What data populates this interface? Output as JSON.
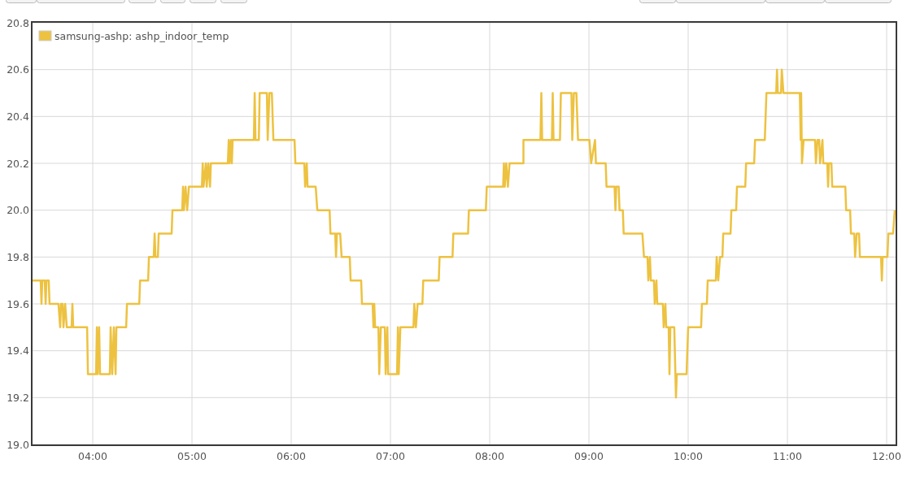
{
  "chart": {
    "chart_data": {
      "type": "line",
      "grid": true,
      "x": [
        203.6,
        208.5,
        209.0,
        209.5,
        211.0,
        211.5,
        212.0,
        213.4,
        213.9,
        219.3,
        220.3,
        220.8,
        221.8,
        222.3,
        223.3,
        224.3,
        227.2,
        227.7,
        228.2,
        236.6,
        237.1,
        242.0,
        242.5,
        243.0,
        243.9,
        244.4,
        250.3,
        250.8,
        251.8,
        252.8,
        253.8,
        254.3,
        260.2,
        260.7,
        268.1,
        268.6,
        273.5,
        274.0,
        276.9,
        277.4,
        277.9,
        279.4,
        279.9,
        287.7,
        288.2,
        294.1,
        294.6,
        295.1,
        296.1,
        297.1,
        298.1,
        306.0,
        306.5,
        307.0,
        308.4,
        308.9,
        309.9,
        310.9,
        311.4,
        321.7,
        322.2,
        322.7,
        323.6,
        324.1,
        324.6,
        337.4,
        337.9,
        338.4,
        340.4,
        340.9,
        345.3,
        345.8,
        346.8,
        348.3,
        349.2,
        362.0,
        362.5,
        367.9,
        368.4,
        369.4,
        369.9,
        374.8,
        375.8,
        383.2,
        383.7,
        386.6,
        387.1,
        387.6,
        389.6,
        390.5,
        395.4,
        395.9,
        402.3,
        402.8,
        409.2,
        409.7,
        410.2,
        410.7,
        412.7,
        413.2,
        414.2,
        416.6,
        417.1,
        418.1,
        418.6,
        424.0,
        424.5,
        425.0,
        426.0,
        427.5,
        433.9,
        434.4,
        435.4,
        436.4,
        439.3,
        439.8,
        449.2,
        449.7,
        457.5,
        458.0,
        466.9,
        467.4,
        477.7,
        478.2,
        488.1,
        488.6,
        489.1,
        490.0,
        491.0,
        492.0,
        500.4,
        500.4,
        510.7,
        511.2,
        511.7,
        517.6,
        518.1,
        518.6,
        522.5,
        523.0,
        529.4,
        529.9,
        530.9,
        532.4,
        533.4,
        540.3,
        541.3,
        543.7,
        544.2,
        550.1,
        550.6,
        555.5,
        556.0,
        556.5,
        558.0,
        558.5,
        560.5,
        561.0,
        572.3,
        573.3,
        575.4,
        575.9,
        576.9,
        577.4,
        579.3,
        579.8,
        580.8,
        581.3,
        584.7,
        585.2,
        586.2,
        586.7,
        588.2,
        588.7,
        589.2,
        591.6,
        592.6,
        593.1,
        599.0,
        600.0,
        607.8,
        608.3,
        611.3,
        611.8,
        616.7,
        617.2,
        618.2,
        619.2,
        620.7,
        621.2,
        625.6,
        626.1,
        629.0,
        629.5,
        634.5,
        635.0,
        639.9,
        640.4,
        646.3,
        647.3,
        653.2,
        653.7,
        654.2,
        656.1,
        656.6,
        657.6,
        667.5,
        668.0,
        668.3,
        668.8,
        669.8,
        676.7,
        677.2,
        678.2,
        679.2,
        679.7,
        681.2,
        681.7,
        684.1,
        684.6,
        685.1,
        686.6,
        687.1,
        695.0,
        695.5,
        697.9,
        698.4,
        700.4,
        700.9,
        701.9,
        703.3,
        703.8,
        716.6,
        717.1,
        717.6,
        720.5,
        721.0,
        723.9,
        724.9
      ],
      "series": [
        {
          "name": "samsung-ashp: ashp_indoor_temp",
          "color": "#edc240",
          "values": [
            19.7,
            19.7,
            19.6,
            19.7,
            19.7,
            19.6,
            19.7,
            19.7,
            19.6,
            19.6,
            19.5,
            19.6,
            19.6,
            19.5,
            19.6,
            19.5,
            19.5,
            19.6,
            19.5,
            19.5,
            19.3,
            19.3,
            19.5,
            19.3,
            19.5,
            19.3,
            19.3,
            19.5,
            19.3,
            19.5,
            19.3,
            19.5,
            19.5,
            19.6,
            19.6,
            19.7,
            19.7,
            19.8,
            19.8,
            19.9,
            19.8,
            19.8,
            19.9,
            19.9,
            20.0,
            20.0,
            20.1,
            20.0,
            20.1,
            20.0,
            20.1,
            20.1,
            20.2,
            20.1,
            20.2,
            20.1,
            20.2,
            20.1,
            20.2,
            20.2,
            20.3,
            20.2,
            20.3,
            20.2,
            20.3,
            20.3,
            20.5,
            20.3,
            20.3,
            20.5,
            20.5,
            20.3,
            20.5,
            20.5,
            20.3,
            20.3,
            20.2,
            20.2,
            20.1,
            20.2,
            20.1,
            20.1,
            20.0,
            20.0,
            19.9,
            19.9,
            19.8,
            19.9,
            19.9,
            19.8,
            19.8,
            19.7,
            19.7,
            19.6,
            19.6,
            19.5,
            19.6,
            19.5,
            19.5,
            19.3,
            19.5,
            19.5,
            19.3,
            19.5,
            19.3,
            19.3,
            19.5,
            19.3,
            19.5,
            19.5,
            19.5,
            19.6,
            19.5,
            19.6,
            19.6,
            19.7,
            19.7,
            19.8,
            19.8,
            19.9,
            19.9,
            20.0,
            20.0,
            20.1,
            20.1,
            20.2,
            20.1,
            20.2,
            20.1,
            20.2,
            20.2,
            20.3,
            20.3,
            20.5,
            20.3,
            20.3,
            20.5,
            20.3,
            20.3,
            20.5,
            20.5,
            20.3,
            20.5,
            20.5,
            20.3,
            20.3,
            20.2,
            20.3,
            20.2,
            20.2,
            20.1,
            20.1,
            20.0,
            20.1,
            20.1,
            20.0,
            20.0,
            19.9,
            19.9,
            19.8,
            19.8,
            19.7,
            19.8,
            19.7,
            19.7,
            19.6,
            19.7,
            19.6,
            19.6,
            19.5,
            19.6,
            19.5,
            19.5,
            19.3,
            19.5,
            19.5,
            19.2,
            19.3,
            19.3,
            19.5,
            19.5,
            19.6,
            19.6,
            19.7,
            19.7,
            19.8,
            19.7,
            19.8,
            19.8,
            19.9,
            19.9,
            20.0,
            20.0,
            20.1,
            20.1,
            20.2,
            20.2,
            20.3,
            20.3,
            20.5,
            20.5,
            20.6,
            20.5,
            20.5,
            20.6,
            20.5,
            20.5,
            20.3,
            20.5,
            20.2,
            20.3,
            20.3,
            20.2,
            20.3,
            20.3,
            20.2,
            20.3,
            20.2,
            20.2,
            20.1,
            20.2,
            20.2,
            20.1,
            20.1,
            20.0,
            20.0,
            19.9,
            19.9,
            19.8,
            19.9,
            19.9,
            19.8,
            19.8,
            19.7,
            19.8,
            19.8,
            19.9,
            19.9,
            20.0
          ]
        }
      ],
      "xlim": [
        203.6,
        725.4
      ],
      "ylim": [
        19.0,
        20.8
      ],
      "xticks": [
        {
          "value": 240,
          "label": "04:00"
        },
        {
          "value": 300,
          "label": "05:00"
        },
        {
          "value": 360,
          "label": "06:00"
        },
        {
          "value": 420,
          "label": "07:00"
        },
        {
          "value": 480,
          "label": "08:00"
        },
        {
          "value": 540,
          "label": "09:00"
        },
        {
          "value": 600,
          "label": "10:00"
        },
        {
          "value": 660,
          "label": "11:00"
        },
        {
          "value": 720,
          "label": "12:00"
        }
      ],
      "yticks": [
        {
          "value": 19.0,
          "label": "19.0"
        },
        {
          "value": 19.2,
          "label": "19.2"
        },
        {
          "value": 19.4,
          "label": "19.4"
        },
        {
          "value": 19.6,
          "label": "19.6"
        },
        {
          "value": 19.8,
          "label": "19.8"
        },
        {
          "value": 20.0,
          "label": "20.0"
        },
        {
          "value": 20.2,
          "label": "20.2"
        },
        {
          "value": 20.4,
          "label": "20.4"
        },
        {
          "value": 20.6,
          "label": "20.6"
        },
        {
          "value": 20.8,
          "label": "20.8"
        }
      ]
    }
  }
}
